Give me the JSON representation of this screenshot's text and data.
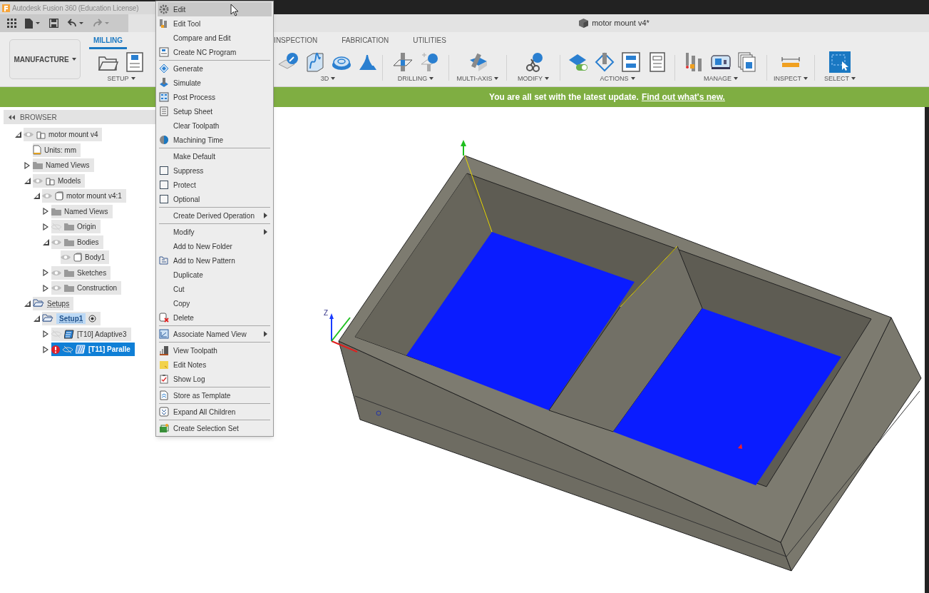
{
  "window": {
    "title": "Autodesk Fusion 360 (Education License)"
  },
  "document_tab": {
    "title": "motor mount v4*"
  },
  "workspace_button": {
    "label": "MANUFACTURE"
  },
  "ribbon_tabs": [
    {
      "label": "MILLING",
      "selected": true
    },
    {
      "label": "INSPECTION",
      "selected": false
    },
    {
      "label": "FABRICATION",
      "selected": false
    },
    {
      "label": "UTILITIES",
      "selected": false
    }
  ],
  "ribbon_groups": [
    {
      "label": "SETUP"
    },
    {
      "label": "3D"
    },
    {
      "label": "DRILLING"
    },
    {
      "label": "MULTI-AXIS"
    },
    {
      "label": "MODIFY"
    },
    {
      "label": "ACTIONS"
    },
    {
      "label": "MANAGE"
    },
    {
      "label": "INSPECT"
    },
    {
      "label": "SELECT"
    }
  ],
  "banner": {
    "text": "You are all set with the latest update.",
    "link": "Find out what's new."
  },
  "browser": {
    "title": "BROWSER",
    "tree": [
      {
        "label": "motor mount v4",
        "kind": "component",
        "expanded": true,
        "visible": true,
        "selected": false,
        "active": false,
        "warning": false,
        "children": [
          {
            "label": "Units: mm",
            "kind": "units",
            "selected": false,
            "active": false,
            "warning": false
          },
          {
            "label": "Named Views",
            "kind": "folder",
            "expanded": false,
            "selected": false,
            "active": false,
            "warning": false
          },
          {
            "label": "Models",
            "kind": "component",
            "expanded": true,
            "visible": true,
            "selected": false,
            "active": false,
            "warning": false,
            "children": [
              {
                "label": "motor mount v4:1",
                "kind": "body",
                "expanded": true,
                "visible": true,
                "selected": false,
                "active": false,
                "warning": false,
                "children": [
                  {
                    "label": "Named Views",
                    "kind": "folder",
                    "expanded": false,
                    "selected": false,
                    "active": false,
                    "warning": false
                  },
                  {
                    "label": "Origin",
                    "kind": "folder",
                    "expanded": false,
                    "visible": false,
                    "selected": false,
                    "active": false,
                    "warning": false
                  },
                  {
                    "label": "Bodies",
                    "kind": "folder",
                    "expanded": true,
                    "visible": true,
                    "selected": false,
                    "active": false,
                    "warning": false,
                    "children": [
                      {
                        "label": "Body1",
                        "kind": "body",
                        "visible": true,
                        "selected": false,
                        "active": false,
                        "warning": false
                      }
                    ]
                  },
                  {
                    "label": "Sketches",
                    "kind": "folder",
                    "expanded": false,
                    "visible": true,
                    "selected": false,
                    "active": false,
                    "warning": false
                  },
                  {
                    "label": "Construction",
                    "kind": "folder",
                    "expanded": false,
                    "visible": true,
                    "selected": false,
                    "active": false,
                    "warning": false
                  }
                ]
              }
            ]
          },
          {
            "label": "Setups",
            "kind": "setups",
            "expanded": true,
            "selected": false,
            "active": false,
            "warning": false,
            "children": [
              {
                "label": "Setup1",
                "kind": "setup",
                "expanded": true,
                "selected": false,
                "active": true,
                "warning": false,
                "children": [
                  {
                    "label": "[T10] Adaptive3",
                    "kind": "adaptive",
                    "expanded": false,
                    "visible": false,
                    "selected": false,
                    "active": false,
                    "warning": false
                  },
                  {
                    "label": "[T11] Paralle",
                    "kind": "parallel",
                    "expanded": false,
                    "visible": false,
                    "selected": true,
                    "active": false,
                    "warning": true
                  }
                ]
              }
            ]
          }
        ]
      }
    ]
  },
  "viewport": {
    "axis_label": "Z"
  },
  "context_menu": {
    "sections": [
      [
        {
          "label": "Edit",
          "kind": "command",
          "selected": true
        },
        {
          "label": "Edit Tool",
          "kind": "command",
          "selected": false
        },
        {
          "label": "Compare and Edit",
          "kind": "command",
          "selected": false
        },
        {
          "label": "Create NC Program",
          "kind": "command",
          "selected": false
        }
      ],
      [
        {
          "label": "Generate",
          "kind": "command",
          "selected": false
        },
        {
          "label": "Simulate",
          "kind": "command",
          "selected": false
        },
        {
          "label": "Post Process",
          "kind": "command",
          "selected": false
        },
        {
          "label": "Setup Sheet",
          "kind": "command",
          "selected": false
        },
        {
          "label": "Clear Toolpath",
          "kind": "command",
          "selected": false
        },
        {
          "label": "Machining Time",
          "kind": "command",
          "selected": false
        }
      ],
      [
        {
          "label": "Make Default",
          "kind": "command",
          "selected": false
        },
        {
          "label": "Suppress",
          "kind": "check",
          "checked": false,
          "selected": false
        },
        {
          "label": "Protect",
          "kind": "check",
          "checked": false,
          "selected": false
        },
        {
          "label": "Optional",
          "kind": "check",
          "checked": false,
          "selected": false
        }
      ],
      [
        {
          "label": "Create Derived Operation",
          "kind": "submenu",
          "selected": false
        }
      ],
      [
        {
          "label": "Modify",
          "kind": "submenu",
          "selected": false
        },
        {
          "label": "Add to New Folder",
          "kind": "command",
          "selected": false
        },
        {
          "label": "Add to New Pattern",
          "kind": "command",
          "selected": false
        },
        {
          "label": "Duplicate",
          "kind": "command",
          "selected": false
        },
        {
          "label": "Cut",
          "kind": "command",
          "selected": false
        },
        {
          "label": "Copy",
          "kind": "command",
          "selected": false
        },
        {
          "label": "Delete",
          "kind": "command",
          "selected": false
        }
      ],
      [
        {
          "label": "Associate Named View",
          "kind": "submenu",
          "selected": false
        }
      ],
      [
        {
          "label": "View Toolpath",
          "kind": "command",
          "selected": false
        },
        {
          "label": "Edit Notes",
          "kind": "command",
          "selected": false
        },
        {
          "label": "Show Log",
          "kind": "command",
          "selected": false
        }
      ],
      [
        {
          "label": "Store as Template",
          "kind": "command",
          "selected": false
        }
      ],
      [
        {
          "label": "Expand All Children",
          "kind": "command",
          "selected": false
        }
      ],
      [
        {
          "label": "Create Selection Set",
          "kind": "command",
          "selected": false
        }
      ]
    ]
  }
}
